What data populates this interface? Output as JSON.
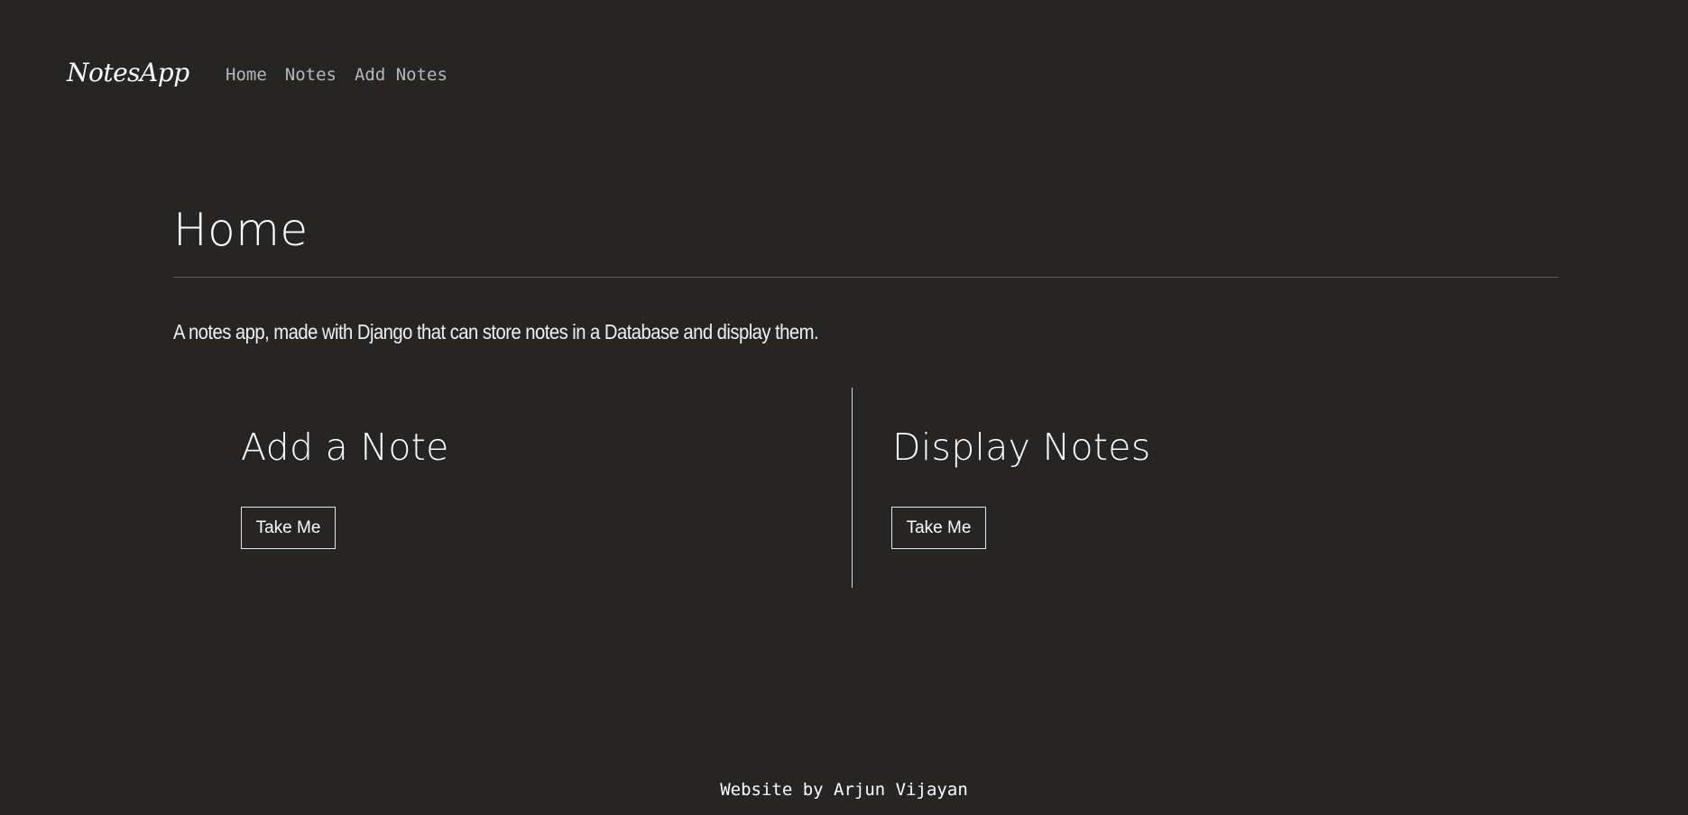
{
  "nav": {
    "brand": "NotesApp",
    "links": [
      {
        "label": "Home"
      },
      {
        "label": "Notes"
      },
      {
        "label": "Add Notes"
      }
    ]
  },
  "main": {
    "title": "Home",
    "description": "A notes app, made with Django that can store notes in a Database and display them.",
    "cards": [
      {
        "title": "Add a Note",
        "button_label": "Take Me"
      },
      {
        "title": "Display Notes",
        "button_label": "Take Me"
      }
    ]
  },
  "footer": {
    "text": "Website by Arjun Vijayan"
  },
  "colors": {
    "background": "#262524",
    "text": "#ffffff",
    "nav_link": "#b8b8b8",
    "divider": "#5a5856"
  }
}
